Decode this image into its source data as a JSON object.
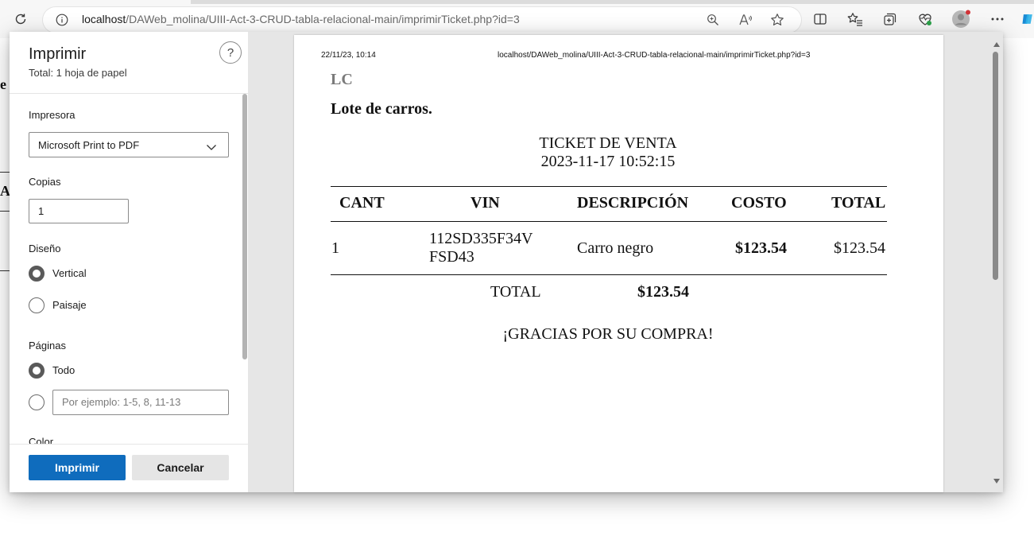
{
  "browser": {
    "url_host": "localhost",
    "url_path": "/DAWeb_molina/UIII-Act-3-CRUD-tabla-relacional-main/imprimirTicket.php?id=3"
  },
  "background_page": {
    "fragments": [
      "e",
      "A"
    ]
  },
  "print_dialog": {
    "title": "Imprimir",
    "subtitle": "Total: 1 hoja de papel",
    "help_label": "?",
    "printer": {
      "label": "Impresora",
      "value": "Microsoft Print to PDF"
    },
    "copies": {
      "label": "Copias",
      "value": "1"
    },
    "layout": {
      "label": "Diseño",
      "options": [
        "Vertical",
        "Paisaje"
      ],
      "selected": "Vertical"
    },
    "pages": {
      "label": "Páginas",
      "options": [
        "Todo"
      ],
      "selected": "Todo",
      "custom_placeholder": "Por ejemplo: 1-5, 8, 11-13"
    },
    "color_label": "Color",
    "print_button": "Imprimir",
    "cancel_button": "Cancelar"
  },
  "preview": {
    "header_date": "22/11/23, 10:14",
    "header_url": "localhost/DAWeb_molina/UIII-Act-3-CRUD-tabla-relacional-main/imprimirTicket.php?id=3",
    "logo": "LC",
    "company": "Lote de carros.",
    "ticket_title": "TICKET DE VENTA",
    "ticket_datetime": "2023-11-17 10:52:15",
    "table": {
      "headers": [
        "CANT",
        "VIN",
        "DESCRIPCIÓN",
        "COSTO",
        "TOTAL"
      ],
      "row": {
        "cant": "1",
        "vin_line1": "112SD335F34V",
        "vin_line2": "FSD43",
        "descripcion": "Carro negro",
        "costo": "$123.54",
        "total": "$123.54"
      }
    },
    "total_label": "TOTAL",
    "total_value": "$123.54",
    "thanks": "¡GRACIAS POR SU COMPRA!"
  },
  "colors": {
    "primary_button": "#0f6cbd",
    "dialog_background": "#e6e6e6"
  }
}
